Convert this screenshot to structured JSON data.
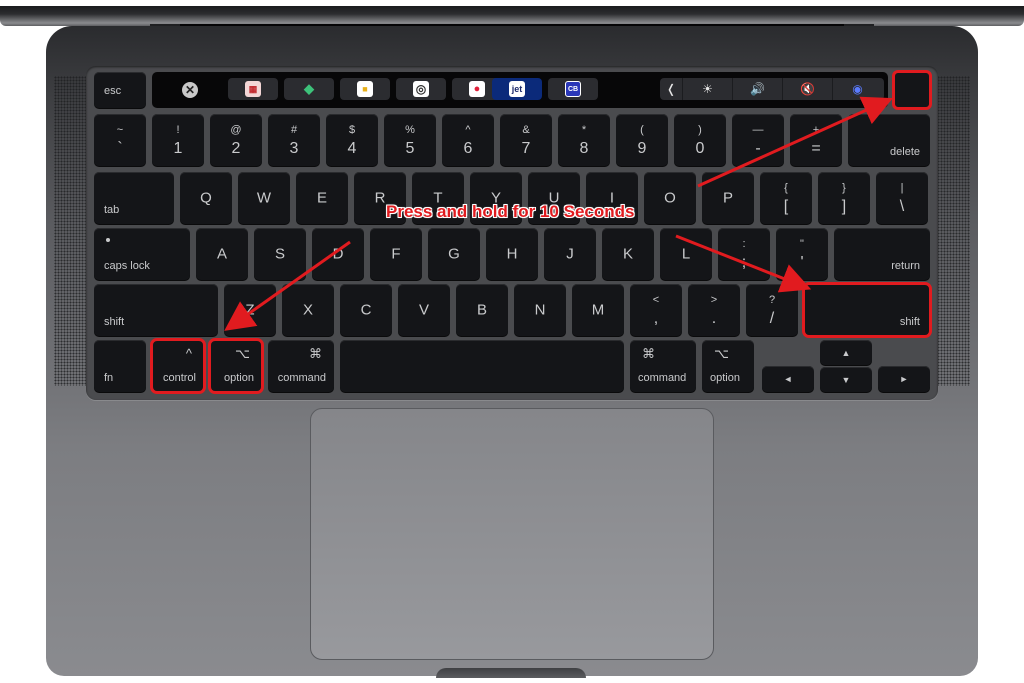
{
  "image": {
    "subject": "MacBook Pro keyboard top view",
    "annotation_text": "Press and hold for 10 Seconds",
    "highlight_color": "#e11b1f"
  },
  "touch_bar": {
    "esc": "esc",
    "close_symbol": "✕",
    "apps": [
      {
        "name": "app-red-square",
        "glyph": "▦",
        "bg": "#f3d6d6",
        "fg": "#c1272d"
      },
      {
        "name": "app-green-leaf",
        "glyph": "◆",
        "bg": "transparent",
        "fg": "#3dc27a"
      },
      {
        "name": "app-yellow-square",
        "glyph": "■",
        "bg": "#ffffff",
        "fg": "#e8b01a"
      },
      {
        "name": "app-circle-logo",
        "glyph": "◎",
        "bg": "#ffffff",
        "fg": "#333333"
      },
      {
        "name": "app-red-dot",
        "glyph": "●",
        "bg": "#ffffff",
        "fg": "#e0203a"
      },
      {
        "name": "app-jet",
        "glyph": "jet",
        "bg": "#ffffff",
        "fg": "#1c2a6b"
      },
      {
        "name": "app-cb",
        "glyph": "CB",
        "bg": "#2a37b8",
        "fg": "#ffffff"
      }
    ],
    "control_strip": {
      "expand": "❬",
      "brightness": "☀",
      "volume": "🔊",
      "mute": "🔇",
      "siri": "◉"
    }
  },
  "rows": {
    "numbers": [
      {
        "top": "~",
        "bot": "`"
      },
      {
        "top": "!",
        "bot": "1"
      },
      {
        "top": "@",
        "bot": "2"
      },
      {
        "top": "#",
        "bot": "3"
      },
      {
        "top": "$",
        "bot": "4"
      },
      {
        "top": "%",
        "bot": "5"
      },
      {
        "top": "^",
        "bot": "6"
      },
      {
        "top": "&",
        "bot": "7"
      },
      {
        "top": "*",
        "bot": "8"
      },
      {
        "top": "(",
        "bot": "9"
      },
      {
        "top": ")",
        "bot": "0"
      },
      {
        "top": "—",
        "bot": "-"
      },
      {
        "top": "+",
        "bot": "="
      }
    ],
    "delete": "delete",
    "tab": "tab",
    "qwerty": [
      "Q",
      "W",
      "E",
      "R",
      "T",
      "Y",
      "U",
      "I",
      "O",
      "P"
    ],
    "brackets": [
      {
        "top": "{",
        "bot": "["
      },
      {
        "top": "}",
        "bot": "]"
      },
      {
        "top": "|",
        "bot": "\\"
      }
    ],
    "caps_lock": "caps lock",
    "asdf": [
      "A",
      "S",
      "D",
      "F",
      "G",
      "H",
      "J",
      "K",
      "L"
    ],
    "semicolon": {
      "top": ":",
      "bot": ";"
    },
    "quote": {
      "top": "\"",
      "bot": "'"
    },
    "return": "return",
    "shift": "shift",
    "zxcv": [
      "Z",
      "X",
      "C",
      "V",
      "B",
      "N",
      "M"
    ],
    "punct": [
      {
        "top": "<",
        "bot": ","
      },
      {
        "top": ">",
        "bot": "."
      },
      {
        "top": "?",
        "bot": "/"
      }
    ],
    "bottom": {
      "fn": "fn",
      "control": "control",
      "control_sym": "^",
      "option": "option",
      "option_sym": "⌥",
      "command": "command",
      "command_sym": "⌘",
      "arrows": {
        "up": "▲",
        "down": "▼",
        "left": "◄",
        "right": "►"
      }
    }
  }
}
